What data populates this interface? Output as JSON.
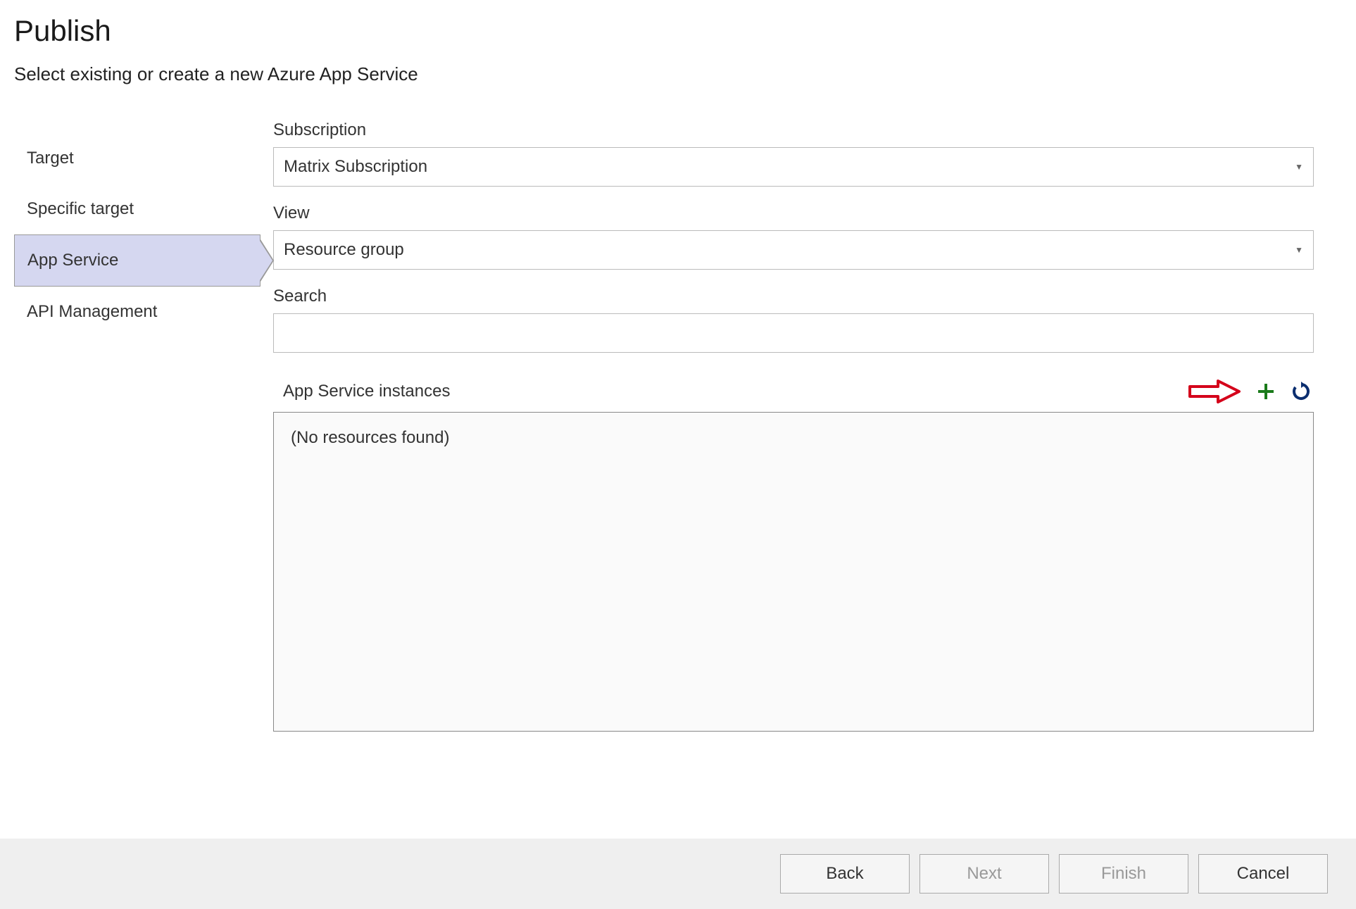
{
  "header": {
    "title": "Publish",
    "subtitle": "Select existing or create a new Azure App Service"
  },
  "sidebar": {
    "items": [
      {
        "label": "Target",
        "selected": false
      },
      {
        "label": "Specific target",
        "selected": false
      },
      {
        "label": "App Service",
        "selected": true
      },
      {
        "label": "API Management",
        "selected": false
      }
    ]
  },
  "form": {
    "subscription": {
      "label": "Subscription",
      "value": "Matrix Subscription"
    },
    "view": {
      "label": "View",
      "value": "Resource group"
    },
    "search": {
      "label": "Search",
      "value": ""
    },
    "instances": {
      "label": "App Service instances",
      "empty_text": "(No resources found)"
    }
  },
  "footer": {
    "back": "Back",
    "next": "Next",
    "finish": "Finish",
    "cancel": "Cancel"
  }
}
